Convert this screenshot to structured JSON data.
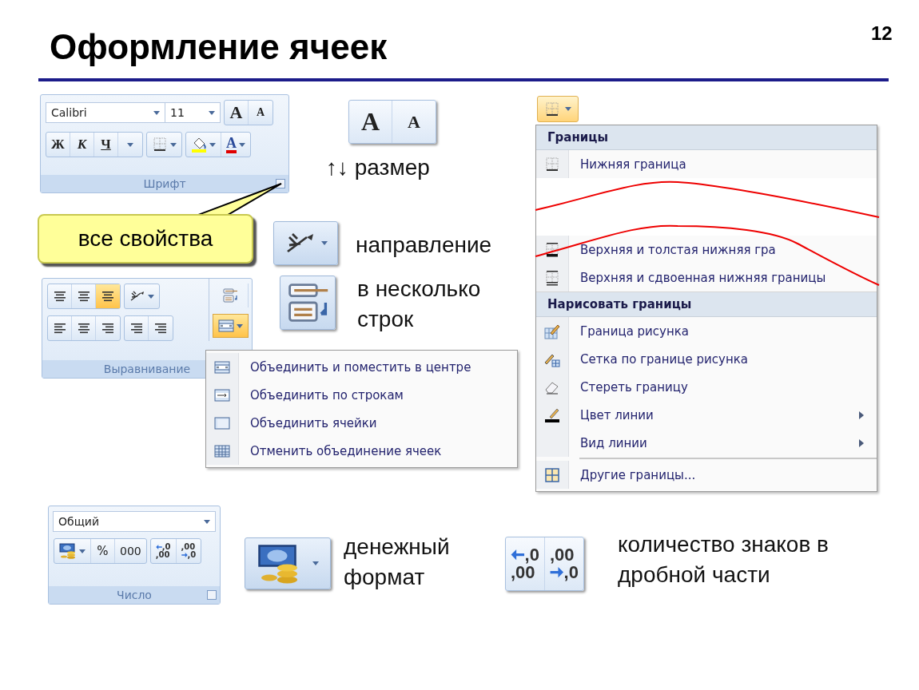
{
  "slide": {
    "title": "Оформление ячеек",
    "page_number": "12"
  },
  "font_group": {
    "font_name": "Calibri",
    "font_size": "11",
    "grow_letter": "A",
    "shrink_letter": "A",
    "styles": [
      "Ж",
      "К",
      "Ч"
    ],
    "font_color_letter": "A",
    "label": "Шрифт"
  },
  "size_buttons": {
    "grow_letter": "A",
    "shrink_letter": "A"
  },
  "callout": {
    "text": "все свойства"
  },
  "captions": [
    "↑↓ размер",
    "направление",
    "в несколько строк",
    "денежный формат",
    "количество знаков в дробной части"
  ],
  "alignment_group": {
    "vertical": [
      {
        "selected": false
      },
      {
        "selected": false
      },
      {
        "selected": true
      }
    ],
    "horizontal": [
      {
        "selected": false
      },
      {
        "selected": false
      },
      {
        "selected": false
      }
    ],
    "merge_open": true,
    "label": "Выравнивание"
  },
  "merge_menu": {
    "items": [
      "Объединить и поместить в центре",
      "Объединить по строкам",
      "Объединить ячейки",
      "Отменить объединение ячеек"
    ]
  },
  "borders_menu": {
    "sections": [
      {
        "header": "Границы",
        "items": [
          {
            "label": "Нижняя граница",
            "kind": "bottom",
            "submenu": false,
            "separator_before": false
          },
          {
            "label": "Верхняя и толстая нижняя гра",
            "kind": "thick",
            "submenu": false,
            "separator_before": false
          },
          {
            "label": "Верхняя и сдвоенная нижняя границы",
            "kind": "double",
            "submenu": false,
            "separator_before": false
          }
        ]
      },
      {
        "header": "Нарисовать границы",
        "items": [
          {
            "label": "Граница рисунка",
            "kind": "draw",
            "submenu": false,
            "separator_before": false
          },
          {
            "label": "Сетка по границе рисунка",
            "kind": "grid",
            "submenu": false,
            "separator_before": false
          },
          {
            "label": "Стереть границу",
            "kind": "eraser",
            "submenu": false,
            "separator_before": false
          },
          {
            "label": "Цвет линии",
            "kind": "pen",
            "submenu": true,
            "separator_before": false
          },
          {
            "label": "Вид линии",
            "kind": "none",
            "submenu": true,
            "separator_before": false
          },
          {
            "label": "Другие границы...",
            "kind": "all",
            "submenu": false,
            "separator_before": true
          }
        ]
      }
    ]
  },
  "number_group": {
    "format": "Общий",
    "percent": "%",
    "thousands": "000",
    "increase_decimal": [
      ",0",
      ",00"
    ],
    "decrease_decimal": [
      ",00",
      ",0"
    ],
    "label": "Число"
  },
  "decimal_buttons": {
    "increase_decimal": [
      ",0",
      ",00"
    ],
    "decrease_decimal": [
      ",00",
      ",0"
    ]
  }
}
